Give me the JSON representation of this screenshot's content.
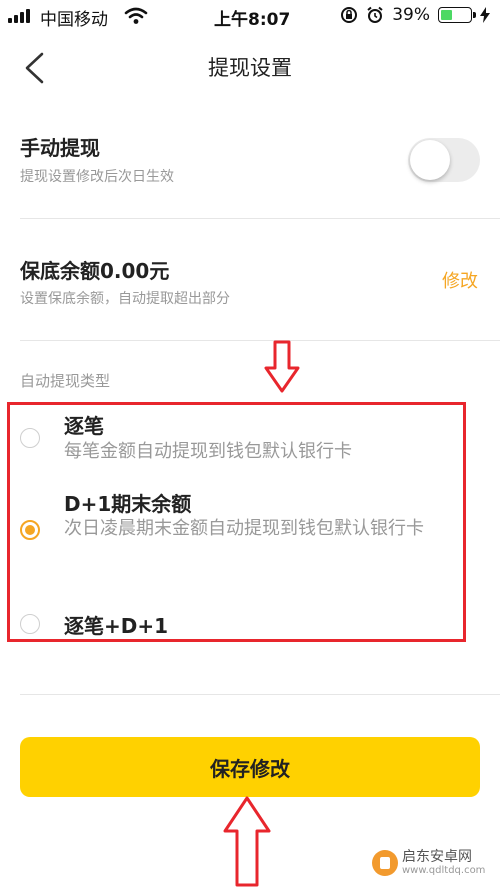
{
  "status_bar": {
    "carrier": "中国移动",
    "time": "上午8:07",
    "battery": "39%",
    "battery_level": 0.39
  },
  "nav": {
    "title": "提现设置"
  },
  "manual_withdraw": {
    "title": "手动提现",
    "subtitle": "提现设置修改后次日生效",
    "enabled": false
  },
  "min_balance": {
    "title": "保底余额0.00元",
    "subtitle": "设置保底余额，自动提取超出部分",
    "edit_label": "修改"
  },
  "auto_type": {
    "label": "自动提现类型",
    "selected": 1,
    "options": [
      {
        "title": "逐笔",
        "desc": "每笔金额自动提现到钱包默认银行卡"
      },
      {
        "title": "D+1期末余额",
        "desc": "次日凌晨期末金额自动提现到钱包默认银行卡"
      },
      {
        "title": "逐笔+D+1",
        "desc": ""
      }
    ]
  },
  "save_button": "保存修改",
  "watermark": {
    "name": "启东安卓网",
    "url": "www.qdltdq.com"
  },
  "colors": {
    "accent": "#f5a623",
    "button": "#ffd100",
    "annotation": "#e8262d",
    "toggle_off": "#ececec"
  }
}
